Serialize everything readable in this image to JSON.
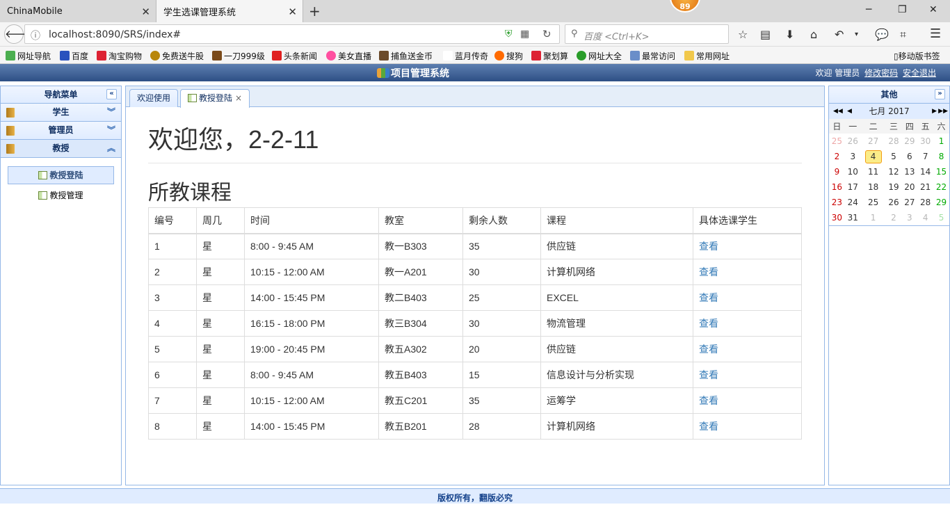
{
  "browser": {
    "tabs": [
      {
        "label": "ChinaMobile",
        "close": "✕"
      },
      {
        "label": "学生选课管理系统",
        "close": "✕"
      }
    ],
    "new_tab": "+",
    "badge": "89",
    "window_buttons": {
      "minimize": "─",
      "maximize": "❐",
      "close": "✕"
    },
    "url": "localhost:8090/SRS/index#",
    "search_placeholder": "百度 <Ctrl+K>",
    "bookmarks": [
      {
        "label": "网址导航",
        "color": "#4caf50"
      },
      {
        "label": "百度",
        "color": "#2a52be"
      },
      {
        "label": "淘宝购物",
        "color": "#d23"
      },
      {
        "label": "免费送牛股",
        "color": "#b8860b"
      },
      {
        "label": "一刀999级",
        "color": "#7a4a1a"
      },
      {
        "label": "头条新闻",
        "color": "#e02020"
      },
      {
        "label": "美女直播",
        "color": "#ff4fa0"
      },
      {
        "label": "捕鱼送金币",
        "color": "#6b4a2a"
      },
      {
        "label": "蓝月传奇",
        "color": "#ffffff"
      },
      {
        "label": "搜狗",
        "color": "#ff6a00"
      },
      {
        "label": "聚划算",
        "color": "#d23"
      },
      {
        "label": "网址大全",
        "color": "#2a9d2a"
      },
      {
        "label": "最常访问",
        "color": "#6a8ec9"
      },
      {
        "label": "常用网址",
        "color": "#f1c84b"
      }
    ],
    "mobile_bookmarks": "移动版书签"
  },
  "app": {
    "title": "项目管理系统",
    "welcome": "欢迎 管理员",
    "change_password": "修改密码",
    "logout": "安全退出"
  },
  "sidebar": {
    "title": "导航菜单",
    "collapse_icon": "«",
    "sections": [
      {
        "label": "学生",
        "chevron": "︾"
      },
      {
        "label": "管理员",
        "chevron": "︾"
      },
      {
        "label": "教授",
        "chevron": "︽"
      }
    ],
    "items": [
      {
        "label": "教授登陆"
      },
      {
        "label": "教授管理"
      }
    ]
  },
  "tabs": [
    {
      "label": "欢迎使用"
    },
    {
      "label": "教授登陆",
      "close": "×"
    }
  ],
  "main": {
    "welcome": "欢迎您，2-2-11",
    "section_title": "所教课程",
    "columns": [
      "编号",
      "周几",
      "时间",
      "教室",
      "剩余人数",
      "课程",
      "具体选课学生"
    ],
    "rows": [
      [
        "1",
        "星",
        "8:00 - 9:45 AM",
        "教一B303",
        "35",
        "供应链",
        "查看"
      ],
      [
        "2",
        "星",
        "10:15 - 12:00 AM",
        "教一A201",
        "30",
        "计算机网络",
        "查看"
      ],
      [
        "3",
        "星",
        "14:00 - 15:45 PM",
        "教二B403",
        "25",
        "EXCEL",
        "查看"
      ],
      [
        "4",
        "星",
        "16:15 - 18:00 PM",
        "教三B304",
        "30",
        "物流管理",
        "查看"
      ],
      [
        "5",
        "星",
        "19:00 - 20:45 PM",
        "教五A302",
        "20",
        "供应链",
        "查看"
      ],
      [
        "6",
        "星",
        "8:00 - 9:45 AM",
        "教五B403",
        "15",
        "信息设计与分析实现",
        "查看"
      ],
      [
        "7",
        "星",
        "10:15 - 12:00 AM",
        "教五C201",
        "35",
        "运筹学",
        "查看"
      ],
      [
        "8",
        "星",
        "14:00 - 15:45 PM",
        "教五B201",
        "28",
        "计算机网络",
        "查看"
      ]
    ]
  },
  "right_panel": {
    "title": "其他",
    "expand_icon": "»",
    "calendar": {
      "month_label": "七月 2017",
      "prev_year": "◀◀",
      "prev_month": "◀",
      "next_month": "▶",
      "next_year": "▶▶",
      "weekdays": [
        "日",
        "一",
        "二",
        "三",
        "四",
        "五",
        "六"
      ],
      "weeks": [
        [
          "25",
          "26",
          "27",
          "28",
          "29",
          "30",
          "1"
        ],
        [
          "2",
          "3",
          "4",
          "5",
          "6",
          "7",
          "8"
        ],
        [
          "9",
          "10",
          "11",
          "12",
          "13",
          "14",
          "15"
        ],
        [
          "16",
          "17",
          "18",
          "19",
          "20",
          "21",
          "22"
        ],
        [
          "23",
          "24",
          "25",
          "26",
          "27",
          "28",
          "29"
        ],
        [
          "30",
          "31",
          "1",
          "2",
          "3",
          "4",
          "5"
        ]
      ],
      "today": "4"
    }
  },
  "footer": "版权所有，翻版必究"
}
